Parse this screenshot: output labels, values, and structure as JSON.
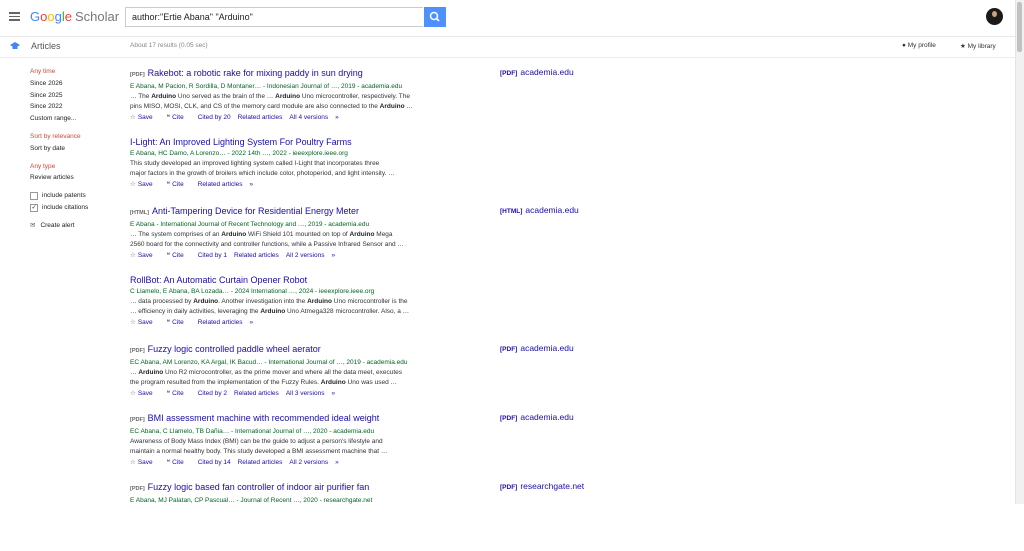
{
  "header": {
    "logo_google": [
      "G",
      "o",
      "o",
      "g",
      "l",
      "e"
    ],
    "logo_scholar": "Scholar",
    "search_value": "author:\"Ertie Abana\" \"Arduino\""
  },
  "subbar": {
    "articles": "Articles",
    "results_count": "About 17 results (0.05 sec)",
    "my_profile": "My profile",
    "my_library": "My library"
  },
  "sidebar": {
    "time": [
      "Any time",
      "Since 2026",
      "Since 2025",
      "Since 2022",
      "Custom range..."
    ],
    "sort": [
      "Sort by relevance",
      "Sort by date"
    ],
    "type": [
      "Any type",
      "Review articles"
    ],
    "include_patents": "include patents",
    "include_citations": "include citations",
    "create_alert": "Create alert"
  },
  "results": [
    {
      "tag": "[PDF]",
      "title": "Rakebot: a robotic rake for mixing paddy in sun drying",
      "authors": "E Abana, M Pacion, R Sordilla, D Montaner… - Indonesian Journal of …, 2019 - academia.edu",
      "snippet": [
        "… The <b>Arduino</b> Uno served as the brain of the … <b>Arduino</b> Uno microcontroller, respectively. The",
        "pins MISO, MOSI, CLK, and CS of the memory card module are also connected to the <b>Arduino</b> …"
      ],
      "actions": {
        "save": "Save",
        "cite": "Cite",
        "cited_by": "Cited by 20",
        "related": "Related articles",
        "versions": "All 4 versions"
      },
      "side": {
        "tag": "[PDF]",
        "site": "academia.edu"
      }
    },
    {
      "tag": "",
      "title": "I-Light: An Improved Lighting System For Poultry Farms",
      "authors": "E Abana, HC Damo, A Lorenzo… - 2022 14th …, 2022 - ieeexplore.ieee.org",
      "snippet": [
        "This study developed an improved lighting system called I-Light that incorporates three",
        "major factors in the growth of broilers which include color, photoperiod, and light intensity. …"
      ],
      "actions": {
        "save": "Save",
        "cite": "Cite",
        "cited_by": "",
        "related": "Related articles",
        "versions": ""
      },
      "side": null
    },
    {
      "tag": "[HTML]",
      "title": "Anti-Tampering Device for Residential Energy Meter",
      "authors": "E Abana - International Journal of Recent Technology and …, 2019 - academia.edu",
      "snippet": [
        "… The system comprises of an <b>Arduino</b> WiFi Shield 101 mounted on top of <b>Arduino</b> Mega",
        "2560 board for the connectivity and controller functions, while a Passive Infrared Sensor and …"
      ],
      "actions": {
        "save": "Save",
        "cite": "Cite",
        "cited_by": "Cited by 1",
        "related": "Related articles",
        "versions": "All 2 versions"
      },
      "side": {
        "tag": "[HTML]",
        "site": "academia.edu"
      }
    },
    {
      "tag": "",
      "title": "RollBot: An Automatic Curtain Opener Robot",
      "authors": "C Llamelo, E Abana, BA Lozada… - 2024 International …, 2024 - ieeexplore.ieee.org",
      "snippet": [
        "… data processed by <b>Arduino</b>. Another investigation into the <b>Arduino</b> Uno microcontroller is the",
        "… efficiency in daily activities, leveraging the <b>Arduino</b> Uno Atmega328 microcontroller. Also, a …"
      ],
      "actions": {
        "save": "Save",
        "cite": "Cite",
        "cited_by": "",
        "related": "Related articles",
        "versions": ""
      },
      "side": null
    },
    {
      "tag": "[PDF]",
      "title": "Fuzzy logic controlled paddle wheel aerator",
      "authors": "EC Abana, AM Lorenzo, KA Argal, IK Bacud… - International Journal of …, 2019 - academia.edu",
      "snippet": [
        "… <b>Arduino</b> Uno R2 microcontroller, as the prime mover and where all the data meet, executes",
        "the program resulted from the implementation of the Fuzzy Rules. <b>Arduino</b> Uno was used …"
      ],
      "actions": {
        "save": "Save",
        "cite": "Cite",
        "cited_by": "Cited by 2",
        "related": "Related articles",
        "versions": "All 3 versions"
      },
      "side": {
        "tag": "[PDF]",
        "site": "academia.edu"
      }
    },
    {
      "tag": "[PDF]",
      "title": "BMI assessment machine with recommended ideal weight",
      "authors": "EC Abana, C Llamelo, TB Dañia… - International Journal of …, 2020 - academia.edu",
      "snippet": [
        "Awareness of Body Mass Index (BMI) can be the guide to adjust a person's lifestyle and",
        "maintain a normal healthy body. This study developed a BMI assessment machine that …"
      ],
      "actions": {
        "save": "Save",
        "cite": "Cite",
        "cited_by": "Cited by 14",
        "related": "Related articles",
        "versions": "All 2 versions"
      },
      "side": {
        "tag": "[PDF]",
        "site": "academia.edu"
      }
    },
    {
      "tag": "[PDF]",
      "title": "Fuzzy logic based fan controller of indoor air purifier fan",
      "authors": "E Abana, MJ Palatan, CP Pascual… - Journal of Recent …, 2020 - researchgate.net",
      "snippet": [],
      "actions": null,
      "side": {
        "tag": "[PDF]",
        "site": "researchgate.net"
      }
    }
  ]
}
